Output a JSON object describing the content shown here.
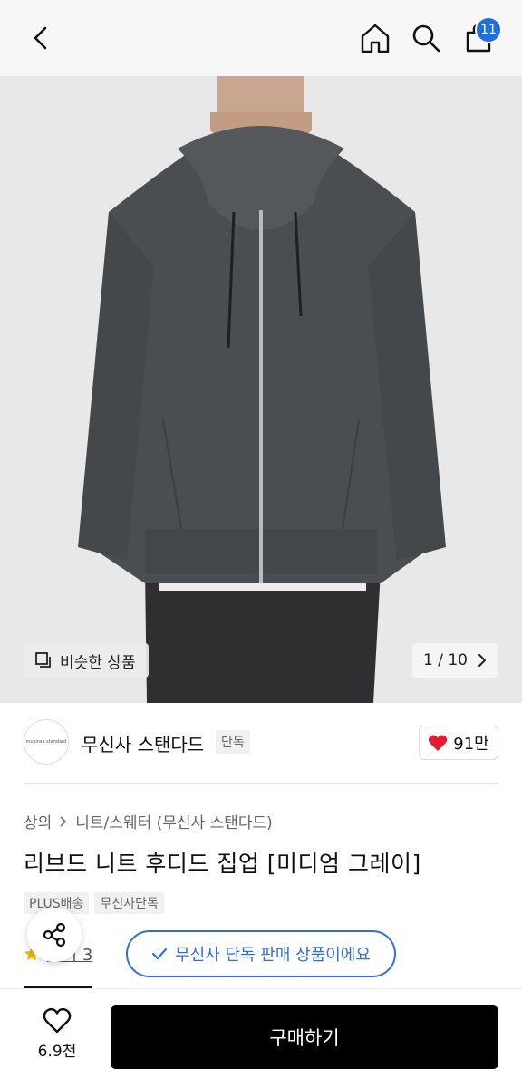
{
  "header": {
    "cart_count": "11"
  },
  "gallery": {
    "similar_label": "비슷한 상품",
    "counter": "1 / 10"
  },
  "brand": {
    "logo_text": "musinsa standard",
    "name": "무신사 스탠다드",
    "tag": "단독",
    "likes": "91만",
    "like_color": "#e11d2e"
  },
  "product": {
    "breadcrumb": [
      "상의",
      "니트/스웨터 (무신사 스탠다드)"
    ],
    "title": "리브드 니트 후디드 집업 [미디엄 그레이]",
    "badges": [
      "PLUS배송",
      "무신사단독"
    ],
    "review_link": "후기 3"
  },
  "toast": {
    "text": "무신사 단독 판매 상품이에요",
    "color": "#2f6fd6"
  },
  "bottom_bar": {
    "wish_count": "6.9천",
    "buy_label": "구매하기"
  }
}
